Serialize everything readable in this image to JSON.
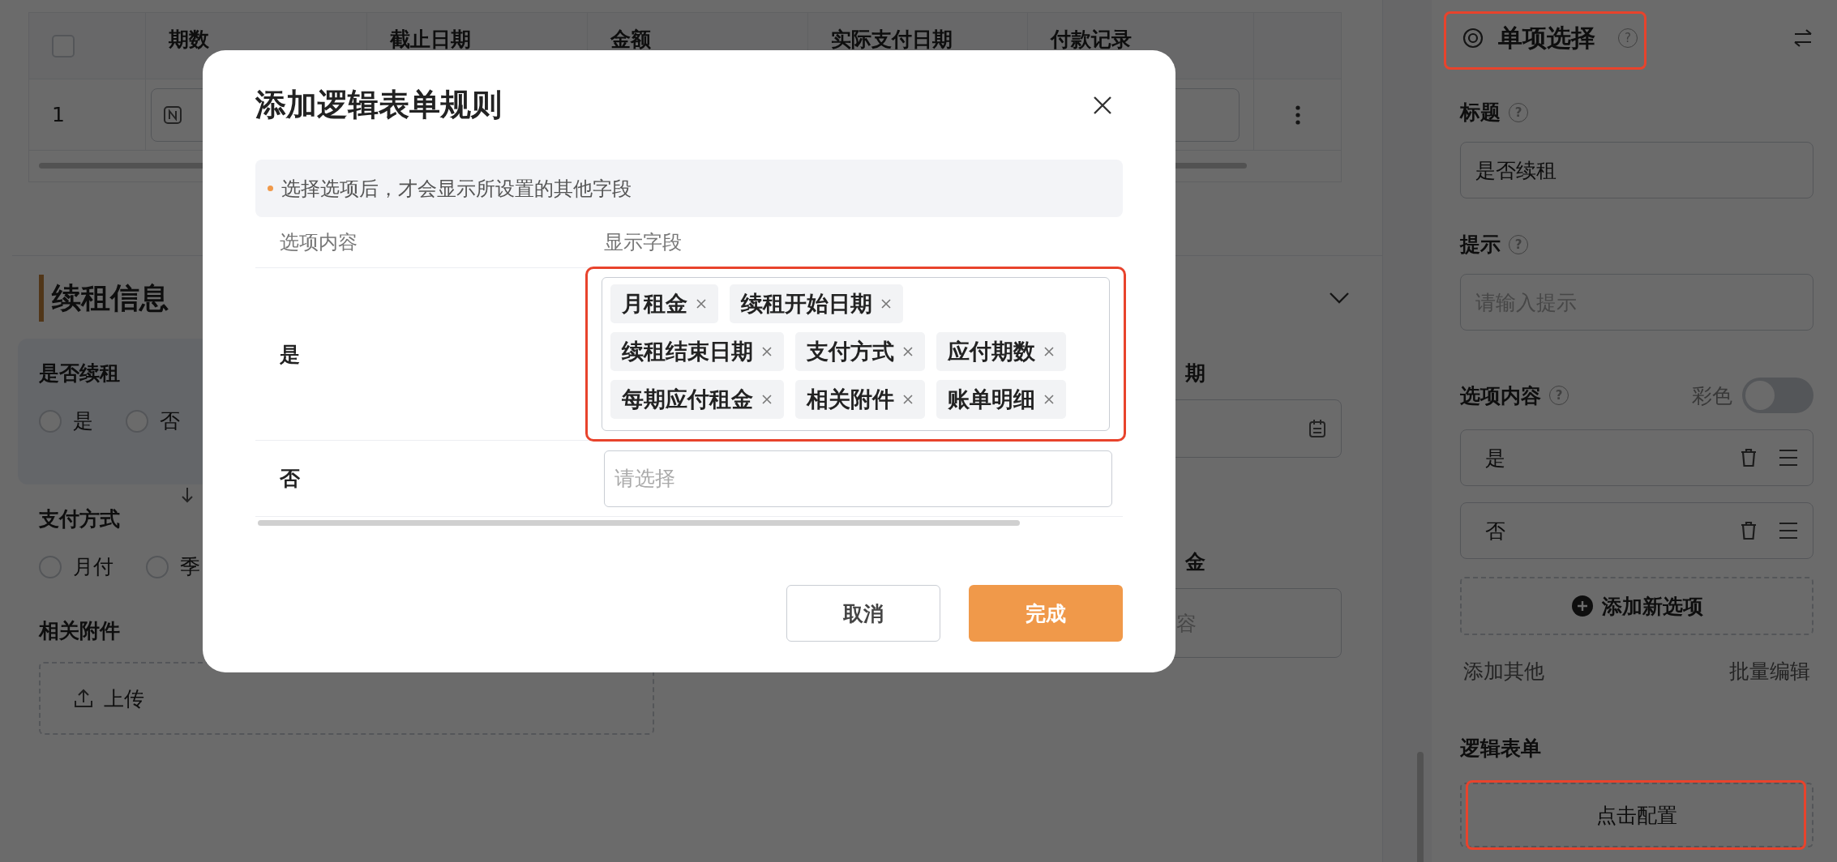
{
  "table": {
    "header_checkbox": {
      "checked": false
    },
    "columns": [
      "期数",
      "截止日期",
      "金额",
      "实际支付日期",
      "付款记录"
    ],
    "rows": [
      {
        "index": "1"
      }
    ]
  },
  "section": {
    "title": "续租信息",
    "expanded": true
  },
  "form": {
    "fields": [
      {
        "label": "是否续租",
        "kind": "radio",
        "selected": true,
        "options": [
          {
            "label": "是",
            "selected": false
          },
          {
            "label": "否",
            "selected": false
          }
        ]
      },
      {
        "label": "支付方式",
        "kind": "radio",
        "selected": false,
        "options": [
          {
            "label": "月付",
            "selected": false
          },
          {
            "label": "季",
            "selected": false
          }
        ]
      },
      {
        "label": "相关附件",
        "kind": "upload",
        "selected": false,
        "button": "上传"
      }
    ],
    "side_fields": [
      {
        "label": "期",
        "kind": "date"
      },
      {
        "label": "金",
        "kind": "text",
        "placeholder": "容"
      }
    ]
  },
  "panel": {
    "type_label": "单项选择",
    "type_help": "?",
    "title_label": "标题",
    "title_help": "?",
    "hint_help": "?",
    "options_help": "?",
    "title_value": "是否续租",
    "hint_label": "提示",
    "hint_placeholder": "请输入提示",
    "options_label": "选项内容",
    "color_label": "彩色",
    "color_on": false,
    "options": [
      "是",
      "否"
    ],
    "add_option": "添加新选项",
    "add_other": "添加其他",
    "bulk_edit": "批量编辑",
    "logic_label": "逻辑表单",
    "configure": "点击配置"
  },
  "dialog": {
    "title": "添加逻辑表单规则",
    "notice": "选择选项后，才会显示所设置的其他字段",
    "columns": [
      "选项内容",
      "显示字段"
    ],
    "rules": [
      {
        "option": "是",
        "fields": [
          "月租金",
          "续租开始日期",
          "续租结束日期",
          "支付方式",
          "应付期数",
          "每期应付租金",
          "相关附件",
          "账单明细"
        ]
      },
      {
        "option": "否",
        "placeholder": "请选择"
      }
    ],
    "buttons": [
      {
        "label": "取消",
        "kind": "secondary"
      },
      {
        "label": "完成",
        "kind": "primary"
      }
    ]
  }
}
